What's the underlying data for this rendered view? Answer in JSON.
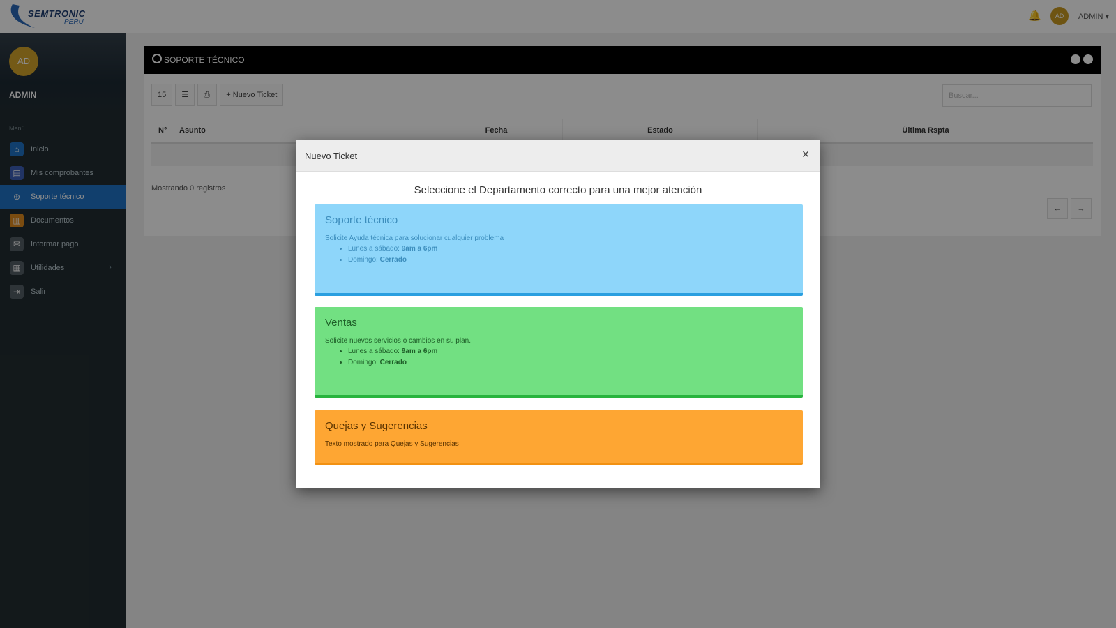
{
  "topbar": {
    "logo_text": "SEMTRONIC",
    "logo_sub": "PERU",
    "user_initials": "AD",
    "user_label": "ADMIN ▾"
  },
  "sidebar": {
    "avatar_initials": "AD",
    "user_name": "ADMIN",
    "menu_title": "Menú",
    "items": [
      {
        "label": "Inicio",
        "icon": "home-icon",
        "color": "#1f73c7"
      },
      {
        "label": "Mis comprobantes",
        "icon": "receipt-icon",
        "color": "#3c5fb8"
      },
      {
        "label": "Soporte técnico",
        "icon": "support-icon",
        "color": "#1f73c7",
        "active": true
      },
      {
        "label": "Documentos",
        "icon": "document-icon",
        "color": "#e08a1e"
      },
      {
        "label": "Informar pago",
        "icon": "payment-icon",
        "color": "#555f66"
      },
      {
        "label": "Utilidades",
        "icon": "tools-icon",
        "color": "#555f66"
      },
      {
        "label": "Salir",
        "icon": "logout-icon",
        "color": "#555f66"
      }
    ]
  },
  "panel": {
    "title": "Soporte técnico",
    "toolbar": {
      "btn1": "15",
      "btn2": "☰",
      "btn3": "⎙",
      "new_ticket": "+ Nuevo Ticket"
    },
    "search_placeholder": "Buscar...",
    "columns": [
      "N°",
      "Asunto",
      "Fecha",
      "Estado",
      "Última Rspta"
    ],
    "footer_note": "Mostrando 0 registros",
    "pager": {
      "prev": "←",
      "next": "→"
    }
  },
  "modal": {
    "title": "Nuevo Ticket",
    "close": "×",
    "lead": "Seleccione el Departamento correcto para una mejor atención",
    "departments": [
      {
        "name": "Soporte técnico",
        "description": "Solicite Ayuda técnica para solucionar cualquier problema",
        "schedule": [
          {
            "label": "Lunes a sábado:",
            "value": "9am a 6pm"
          },
          {
            "label": "Domingo:",
            "value": "Cerrado"
          }
        ],
        "bg": "#8ed6fa"
      },
      {
        "name": "Ventas",
        "description": "Solicite nuevos servicios o cambios en su plan.",
        "schedule": [
          {
            "label": "Lunes a sábado:",
            "value": "9am a 6pm"
          },
          {
            "label": "Domingo:",
            "value": "Cerrado"
          }
        ],
        "bg": "#72e082"
      },
      {
        "name": "Quejas y Sugerencias",
        "description": "Texto mostrado para Quejas y Sugerencias",
        "bg": "#fea633"
      }
    ]
  }
}
